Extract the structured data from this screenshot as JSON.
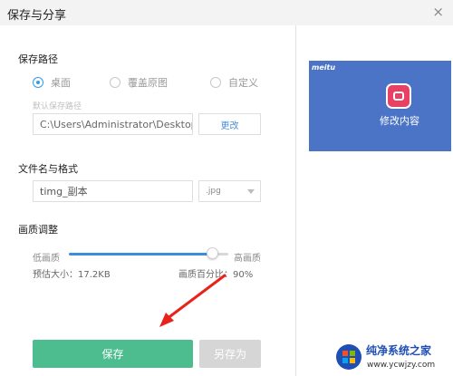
{
  "dialog": {
    "title": "保存与分享",
    "close_icon": "×"
  },
  "save_path": {
    "heading": "保存路径",
    "options": [
      {
        "label": "桌面",
        "selected": true
      },
      {
        "label": "覆盖原图",
        "selected": false
      },
      {
        "label": "自定义",
        "selected": false
      }
    ],
    "default_hint": "默认保存路径",
    "path_value": "C:\\Users\\Administrator\\Desktop",
    "change_button": "更改"
  },
  "file": {
    "heading": "文件名与格式",
    "filename": "timg_副本",
    "format": ".jpg"
  },
  "quality": {
    "heading": "画质调整",
    "low_label": "低画质",
    "high_label": "高画质",
    "level_fraction": 0.9,
    "estimate_size": "预估大小：17.2KB",
    "percent_text": "画质百分比：90%"
  },
  "actions": {
    "save": "保存",
    "save_as": "另存为"
  },
  "preview": {
    "brand": "meitu",
    "caption": "修改内容",
    "bg_color": "#4b74c6",
    "icon_color": "#e84163"
  },
  "colors": {
    "accent": "#3b8de0",
    "primary_button": "#4dbd8f",
    "disabled_button": "#d6d6d6",
    "annotation_arrow": "#e8231c"
  },
  "watermark": {
    "title": "纯净系统之家",
    "url": "www.ycwjzy.com"
  }
}
